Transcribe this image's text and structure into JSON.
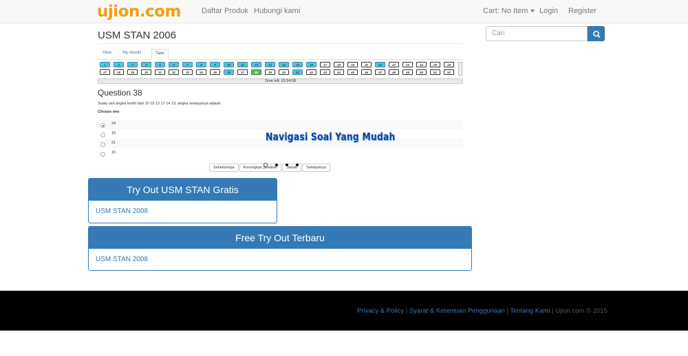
{
  "navbar": {
    "logo": "ujion.com",
    "links": [
      "Daftar Produk",
      "Hubungi kami"
    ],
    "cart": "Cart: No Item",
    "login": "Login",
    "register": "Register"
  },
  "page": {
    "title": "USM STAN 2006"
  },
  "search": {
    "placeholder": "Cari",
    "icon": "search-icon"
  },
  "quiz": {
    "tabs": [
      "View",
      "My results",
      "Take"
    ],
    "active_tab": "Take",
    "nav_row1": [
      "1",
      "2",
      "3",
      "4",
      "5",
      "6",
      "7",
      "8",
      "9",
      "10",
      "11",
      "12",
      "13",
      "14",
      "15",
      "16",
      "17",
      "18",
      "19",
      "20",
      "21",
      "22",
      "23",
      "24",
      "25",
      "26"
    ],
    "nav_row2": [
      "27",
      "28",
      "29",
      "30",
      "31",
      "32",
      "33",
      "34",
      "35",
      "36",
      "37",
      "38",
      "39",
      "40",
      "41",
      "42",
      "43",
      "44",
      "45",
      "46",
      "47",
      "48",
      "49",
      "50",
      "51",
      "52"
    ],
    "answered": [
      "1",
      "2",
      "3",
      "4",
      "5",
      "6",
      "7",
      "8",
      "9",
      "10",
      "11",
      "12",
      "13",
      "14",
      "15",
      "16",
      "21",
      "36",
      "41"
    ],
    "current": "38",
    "timer": "Time left: 01:54:58",
    "question_title": "Question 38",
    "question_text": "Suatu seri angka terdiri dari 10 15 12 17 14 19, angka selanjutnya adalah :",
    "choose_label": "Choose one",
    "options": [
      "24",
      "16",
      "21",
      "15"
    ],
    "selected_option": "24",
    "buttons": [
      "Sebelumnya",
      "Kosongkan jawaban",
      "Jawab",
      "Selanjutnya"
    ],
    "overlay_caption": "Navigasi Soal Yang Mudah",
    "slide_count": 4,
    "active_slide": 1
  },
  "panels": [
    {
      "heading": "Try Out USM STAN Gratis",
      "link": "USM STAN 2008"
    },
    {
      "heading": "Free Try Out Terbaru",
      "link": "USM STAN 2008"
    }
  ],
  "footer": {
    "links": [
      "Privacy & Policy",
      "Syarat & Ketentuan Penggunaan",
      "Tentang Kami"
    ],
    "copyright": "Ujion.com © 2015"
  },
  "colors": {
    "brand": "#f39c12",
    "primary": "#337ab7",
    "answered": "#5bc0de",
    "current": "#5cb85c"
  }
}
